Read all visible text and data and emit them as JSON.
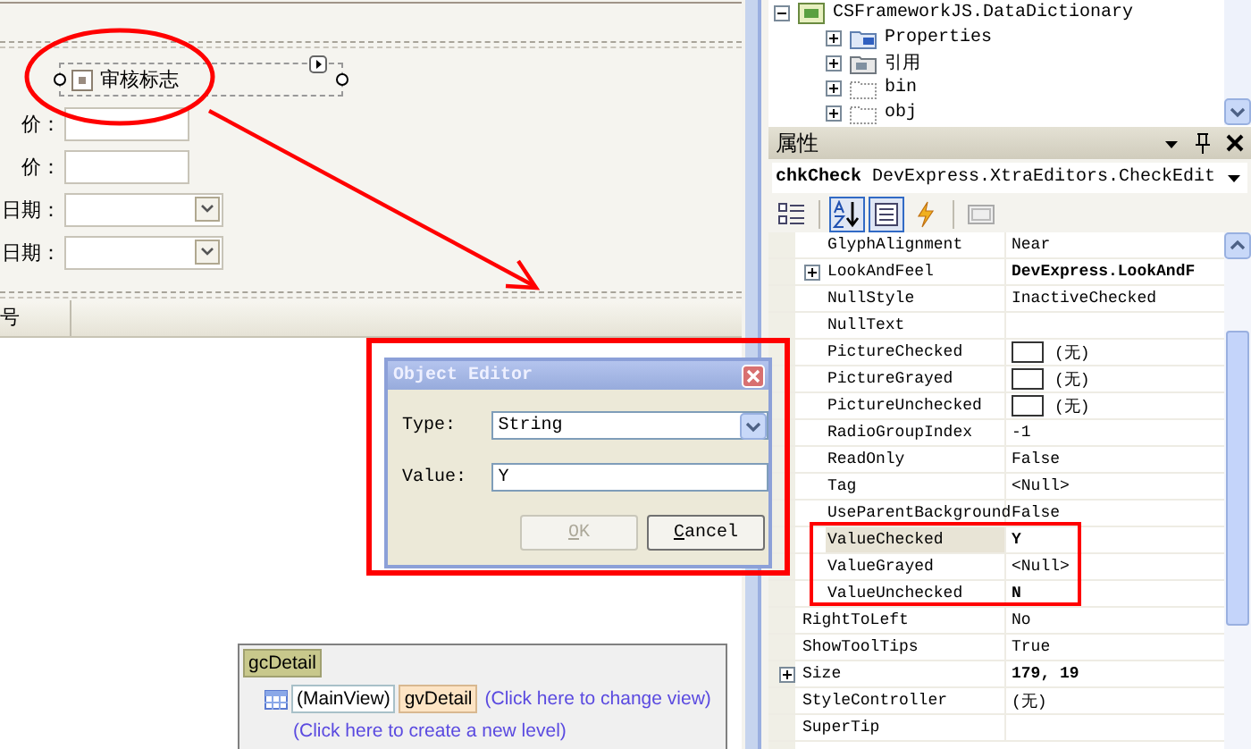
{
  "designer": {
    "checkbox": {
      "label": "审核标志",
      "grayed": true
    },
    "fields": [
      {
        "label": "价：",
        "kind": "text"
      },
      {
        "label": "价：",
        "kind": "text"
      },
      {
        "label": "日期：",
        "kind": "date"
      },
      {
        "label": "日期：",
        "kind": "date"
      }
    ],
    "grid_columns": [
      "号"
    ],
    "level_designer": {
      "grid_name": "gcDetail",
      "main_view": "(MainView)",
      "view_name": "gvDetail",
      "change_view_link": "(Click here to change view)",
      "new_level_link": "(Click here to create a new level)"
    }
  },
  "object_editor": {
    "title": "Object Editor",
    "type_label": "Type:",
    "type_value": "String",
    "value_label": "Value:",
    "value": "Y",
    "buttons": [
      {
        "label": "OK",
        "disabled": true
      },
      {
        "label": "Cancel",
        "disabled": false
      }
    ]
  },
  "solution_tree": {
    "items": [
      {
        "label": "CSFrameworkJS.DataDictionary",
        "kind": "project",
        "expanded": true,
        "children": [
          {
            "label": "Properties",
            "kind": "properties",
            "expanded": false
          },
          {
            "label": "引用",
            "kind": "references",
            "expanded": false
          },
          {
            "label": "bin",
            "kind": "folder",
            "expanded": false
          },
          {
            "label": "obj",
            "kind": "folder",
            "expanded": false
          }
        ]
      }
    ]
  },
  "properties": {
    "title": "属性",
    "object_name": "chkCheck",
    "object_type": "DevExpress.XtraEditors.CheckEdit",
    "toolbar": [
      {
        "kind": "categorized",
        "selected": false
      },
      {
        "kind": "alphabetical",
        "selected": true
      },
      {
        "kind": "properties",
        "selected": true
      },
      {
        "kind": "events",
        "selected": false
      },
      {
        "kind": "pages",
        "selected": false
      }
    ],
    "rows": [
      {
        "children": [
          {
            "name": "GlyphAlignment",
            "value": "Near",
            "selected": false
          },
          {
            "name": "LookAndFeel",
            "value": "DevExpress.LookAndF",
            "expandable": true,
            "bold": true,
            "selected": false
          },
          {
            "name": "NullStyle",
            "value": "InactiveChecked",
            "selected": false
          },
          {
            "name": "NullText",
            "selected": false
          },
          {
            "name": "PictureChecked",
            "value": "(无)",
            "swatch": true,
            "selected": false
          },
          {
            "name": "PictureGrayed",
            "value": "(无)",
            "swatch": true,
            "selected": false
          },
          {
            "name": "PictureUnchecked",
            "value": "(无)",
            "swatch": true,
            "selected": false
          },
          {
            "name": "RadioGroupIndex",
            "value": "-1",
            "selected": false
          },
          {
            "name": "ReadOnly",
            "value": "False",
            "selected": false
          },
          {
            "name": "Tag",
            "value": "<Null>",
            "selected": false
          },
          {
            "name": "UseParentBackground",
            "value": "False",
            "selected": false
          },
          {
            "name": "ValueChecked",
            "value": "Y",
            "bold": true,
            "selected": true
          },
          {
            "name": "ValueGrayed",
            "value": "<Null>",
            "selected": false
          },
          {
            "name": "ValueUnchecked",
            "value": "N",
            "bold": true,
            "selected": false
          }
        ]
      },
      {
        "name": "RightToLeft",
        "value": "No",
        "selected": false
      },
      {
        "name": "ShowToolTips",
        "value": "True",
        "selected": false
      },
      {
        "name": "Size",
        "value": "179, 19",
        "expandable": true,
        "bold": true,
        "selected": false
      },
      {
        "name": "StyleController",
        "value": "(无)",
        "selected": false
      },
      {
        "name": "SuperTip",
        "selected": false
      }
    ]
  }
}
